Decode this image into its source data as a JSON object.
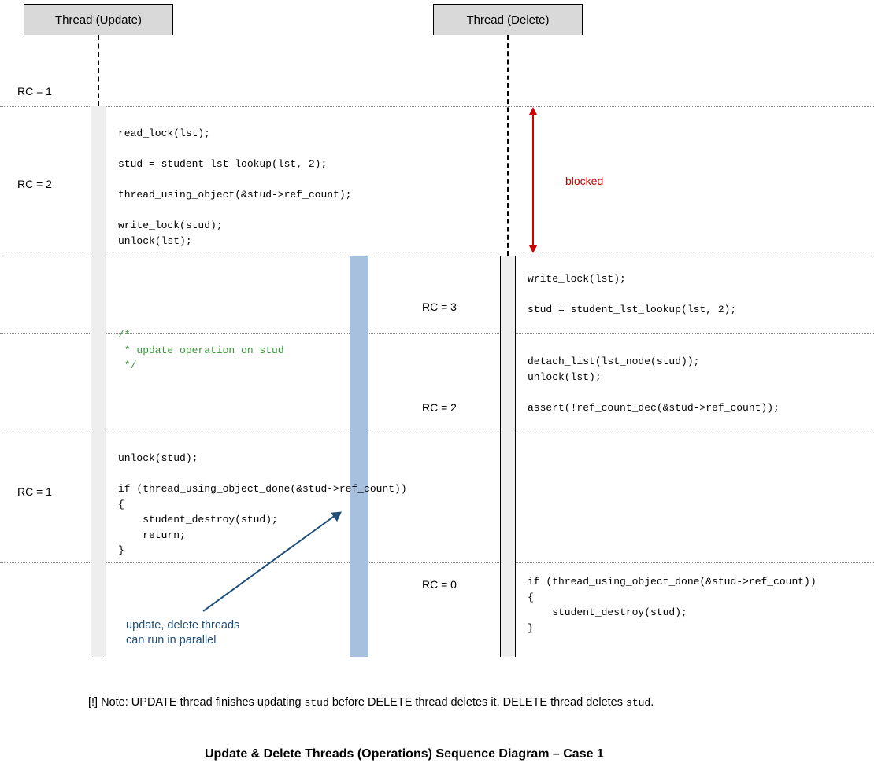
{
  "headers": {
    "update": "Thread (Update)",
    "delete": "Thread (Delete)"
  },
  "rc_labels": {
    "rc1a": "RC = 1",
    "rc2a": "RC = 2",
    "rc3": "RC = 3",
    "rc2b": "RC = 2",
    "rc1b": "RC = 1",
    "rc0": "RC = 0"
  },
  "blocked_label": "blocked",
  "parallel_note": "update, delete threads\ncan run in parallel",
  "code": {
    "update_block1": "read_lock(lst);\n\nstud = student_lst_lookup(lst, 2);\n\nthread_using_object(&stud->ref_count);\n\nwrite_lock(stud);\nunlock(lst);",
    "update_comment": "/*\n * update operation on stud\n */",
    "update_block3": "unlock(stud);\n\nif (thread_using_object_done(&stud->ref_count))\n{\n    student_destroy(stud);\n    return;\n}",
    "delete_block1": "write_lock(lst);\n\nstud = student_lst_lookup(lst, 2);",
    "delete_block2": "detach_list(lst_node(stud));\nunlock(lst);\n\nassert(!ref_count_dec(&stud->ref_count));",
    "delete_block3": "if (thread_using_object_done(&stud->ref_count))\n{\n    student_destroy(stud);\n}"
  },
  "note": {
    "prefix": "[!] Note: UPDATE thread finishes updating ",
    "code1": "stud",
    "mid": " before DELETE thread deletes it. DELETE thread deletes ",
    "code2": "stud",
    "suffix": "."
  },
  "title": "Update & Delete Threads (Operations) Sequence Diagram – Case 1"
}
